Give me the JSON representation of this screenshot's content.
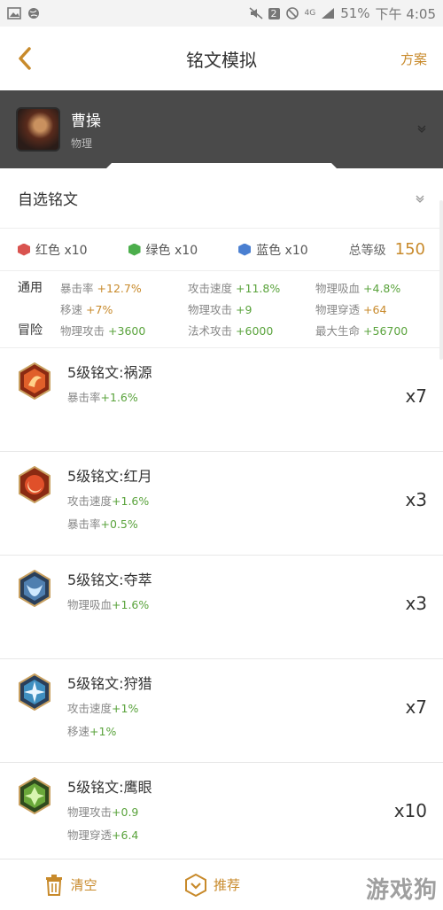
{
  "status": {
    "battery": "51%",
    "time": "下午 4:05",
    "sim": "2",
    "network": "4G"
  },
  "header": {
    "title": "铭文模拟",
    "action": "方案"
  },
  "hero": {
    "name": "曹操",
    "type": "物理"
  },
  "custom": {
    "title": "自选铭文"
  },
  "summary": {
    "red_label": "红色 x10",
    "green_label": "绿色 x10",
    "blue_label": "蓝色 x10",
    "total_label": "总等级",
    "total_value": "150",
    "colors": {
      "red": "#d9534f",
      "green": "#4cae4c",
      "blue": "#4a7fd1"
    }
  },
  "stats": {
    "rows": [
      {
        "category": "通用",
        "cells": [
          {
            "name": "暴击率",
            "value": "+12.7%",
            "color": "orange"
          },
          {
            "name": "攻击速度",
            "value": "+11.8%",
            "color": "green"
          },
          {
            "name": "物理吸血",
            "value": "+4.8%",
            "color": "green"
          }
        ]
      },
      {
        "category": "",
        "cells": [
          {
            "name": "移速",
            "value": "+7%",
            "color": "orange"
          },
          {
            "name": "物理攻击",
            "value": "+9",
            "color": "green"
          },
          {
            "name": "物理穿透",
            "value": "+64",
            "color": "orange"
          }
        ]
      },
      {
        "category": "冒险",
        "cells": [
          {
            "name": "物理攻击",
            "value": "+3600",
            "color": "green"
          },
          {
            "name": "法术攻击",
            "value": "+6000",
            "color": "green"
          },
          {
            "name": "最大生命",
            "value": "+56700",
            "color": "green"
          }
        ]
      }
    ]
  },
  "runes": [
    {
      "name": "5级铭文:祸源",
      "count": "x7",
      "icon": "red-rune-icon",
      "attrs": [
        {
          "name": "暴击率",
          "value": "+1.6%"
        }
      ]
    },
    {
      "name": "5级铭文:红月",
      "count": "x3",
      "icon": "red-moon-rune-icon",
      "attrs": [
        {
          "name": "攻击速度",
          "value": "+1.6%"
        },
        {
          "name": "暴击率",
          "value": "+0.5%"
        }
      ]
    },
    {
      "name": "5级铭文:夺萃",
      "count": "x3",
      "icon": "blue-rune-icon",
      "attrs": [
        {
          "name": "物理吸血",
          "value": "+1.6%"
        }
      ]
    },
    {
      "name": "5级铭文:狩猎",
      "count": "x7",
      "icon": "blue-star-rune-icon",
      "attrs": [
        {
          "name": "攻击速度",
          "value": "+1%"
        },
        {
          "name": "移速",
          "value": "+1%"
        }
      ]
    },
    {
      "name": "5级铭文:鹰眼",
      "count": "x10",
      "icon": "green-rune-icon",
      "attrs": [
        {
          "name": "物理攻击",
          "value": "+0.9"
        },
        {
          "name": "物理穿透",
          "value": "+6.4"
        }
      ]
    }
  ],
  "bottom": {
    "clear": "清空",
    "recommend": "推荐",
    "watermark": "游戏狗"
  }
}
